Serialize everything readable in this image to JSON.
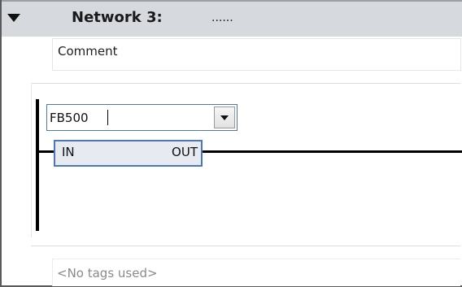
{
  "network": {
    "title": "Network 3:",
    "title_dots": "......",
    "comment": "Comment"
  },
  "block": {
    "name": "FB500",
    "pin_in": "IN",
    "pin_out": "OUT"
  },
  "tags": {
    "placeholder": "<No tags used>"
  },
  "icons": {
    "collapse": "collapse-triangle-icon",
    "dropdown": "chevron-down-icon"
  },
  "colors": {
    "header_bg": "#d6d9dd",
    "block_border": "#4a78b8",
    "block_fill": "#e8eaf2"
  }
}
